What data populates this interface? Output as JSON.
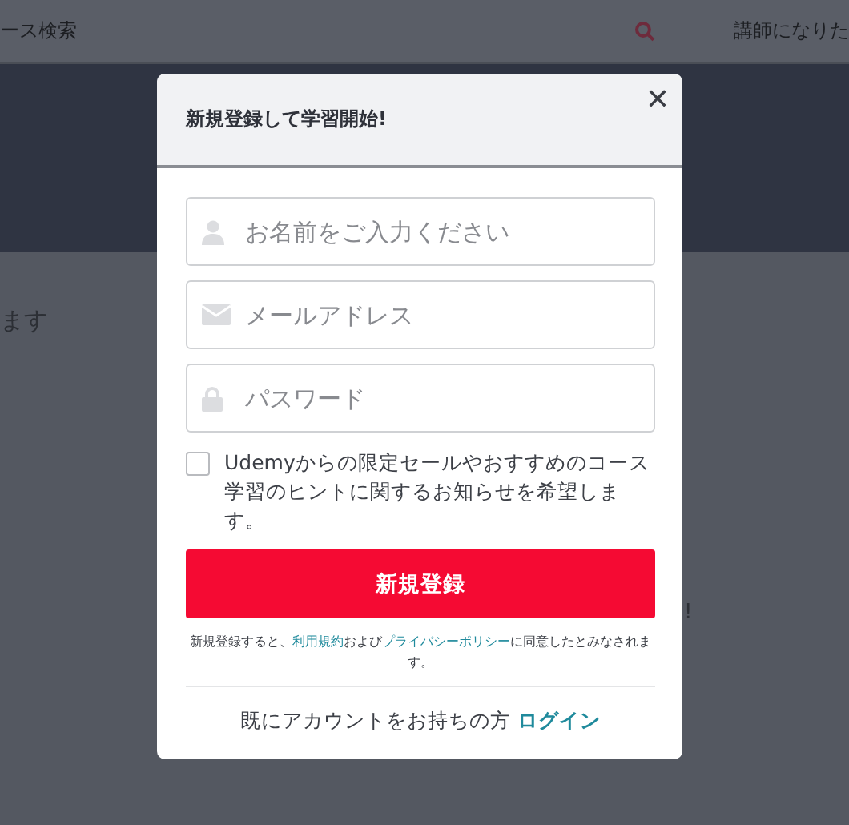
{
  "background": {
    "search_text": "ース検索",
    "nav_link": "講師になりた",
    "body_text": "ます",
    "side_mark": "!"
  },
  "modal": {
    "title": "新規登録して学習開始!",
    "close": "✕",
    "fields": [
      {
        "kind": "user",
        "placeholder": "お名前をご入力ください"
      },
      {
        "kind": "mail",
        "placeholder": "メールアドレス"
      },
      {
        "kind": "lock",
        "placeholder": "パスワード"
      }
    ],
    "newsletter": {
      "label": "Udemyからの限定セールやおすすめのコース学習のヒントに関するお知らせを希望します。",
      "checked": false
    },
    "submit": "新規登録",
    "terms": {
      "before": "新規登録すると、",
      "link1": "利用規約",
      "middle": "および",
      "link2": "プライバシーポリシー",
      "after": "に同意したとみなされます。"
    },
    "login": {
      "text": "既にアカウントをお持ちの方",
      "link": "ログイン"
    }
  }
}
